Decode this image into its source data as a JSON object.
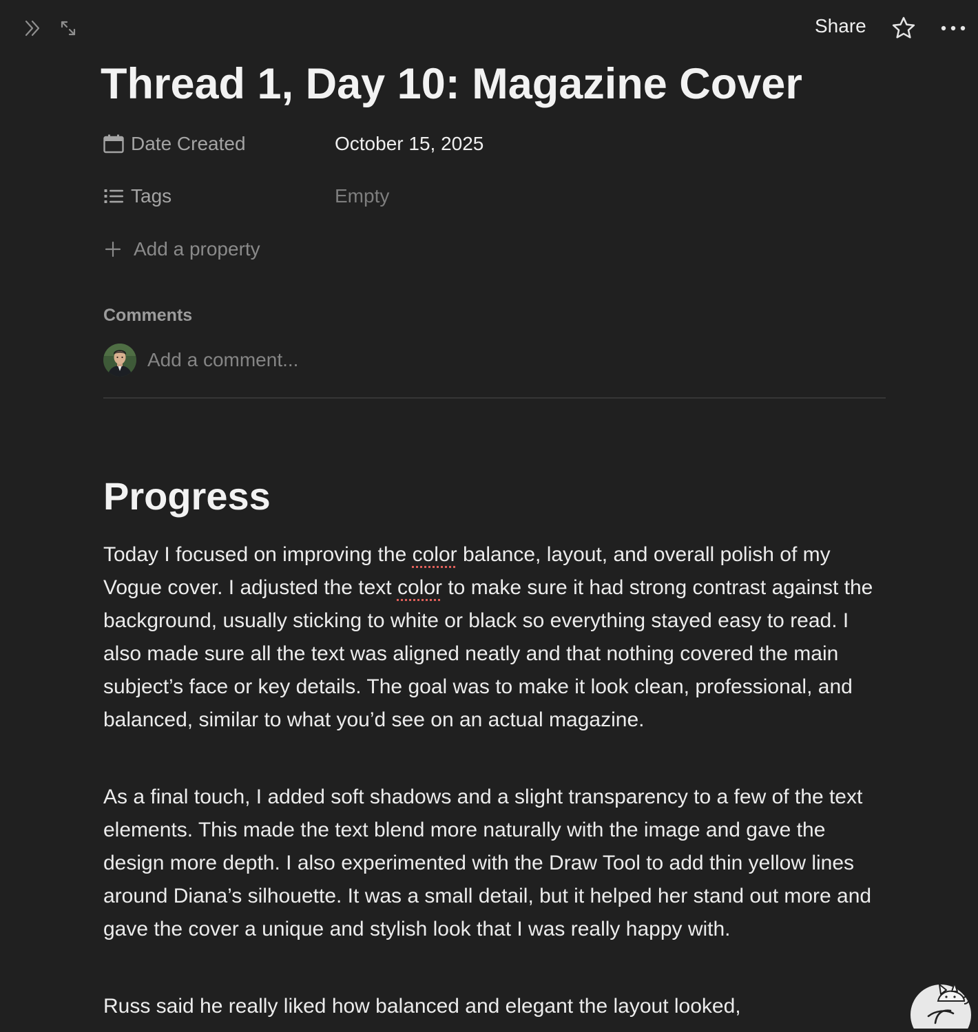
{
  "topbar": {
    "share_label": "Share",
    "icons": [
      "double-chevron-right-icon",
      "expand-diagonal-icon",
      "star-icon",
      "more-horizontal-icon"
    ]
  },
  "page": {
    "title": "Thread 1, Day 10: Magazine Cover"
  },
  "properties": {
    "date_created": {
      "icon": "calendar-icon",
      "label": "Date Created",
      "value": "October 15, 2025"
    },
    "tags": {
      "icon": "list-icon",
      "label": "Tags",
      "value": "Empty"
    },
    "add_property_label": "Add a property"
  },
  "comments": {
    "heading": "Comments",
    "placeholder": "Add a comment..."
  },
  "content": {
    "heading": "Progress",
    "p1": {
      "a": "Today I focused on improving the ",
      "b": "color",
      "c": " balance, layout, and overall polish of my Vogue cover. I adjusted the text ",
      "d": "color",
      "e": " to make sure it had strong contrast against the background, usually sticking to white or black so everything stayed easy to read. I also made sure all the text was aligned neatly and that nothing covered the main subject’s face or key details. The goal was to make it look clean, professional, and balanced, similar to what you’d see on an actual magazine."
    },
    "p2": "As a final touch, I added soft shadows and a slight transparency to a few of the text elements. This made the text blend more naturally with the image and gave the design more depth. I also experimented with the Draw Tool to add thin yellow lines around Diana’s silhouette. It was a small detail, but it helped her stand out more and gave the cover a unique and stylish look that I was really happy with.",
    "p3": "Russ said he really liked how balanced and elegant the layout looked,"
  },
  "colors": {
    "background": "#202020",
    "text": "#ececec",
    "muted": "#a4a4a4",
    "placeholder": "#858585",
    "divider": "#363636",
    "spellcheck": "#e0605a"
  }
}
